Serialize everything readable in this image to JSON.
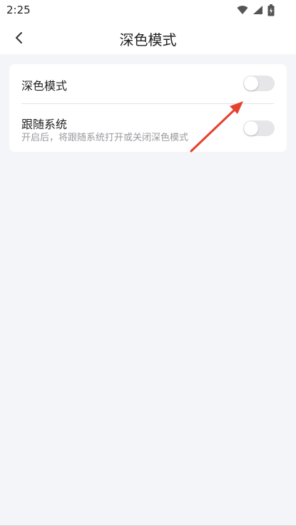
{
  "status_bar": {
    "time": "2:25",
    "icons": [
      "wifi-icon",
      "signal-icon",
      "battery-icon"
    ]
  },
  "header": {
    "back_icon": "chevron-left-icon",
    "title": "深色模式"
  },
  "settings": {
    "dark_mode": {
      "label": "深色模式",
      "enabled": false
    },
    "follow_system": {
      "label": "跟随系统",
      "description": "开启后，将跟随系统打开或关闭深色模式",
      "enabled": false
    }
  },
  "colors": {
    "background": "#f4f5f8",
    "card": "#ffffff",
    "toggle_off": "#e6e6e9",
    "annotation_arrow": "#e5412f"
  }
}
